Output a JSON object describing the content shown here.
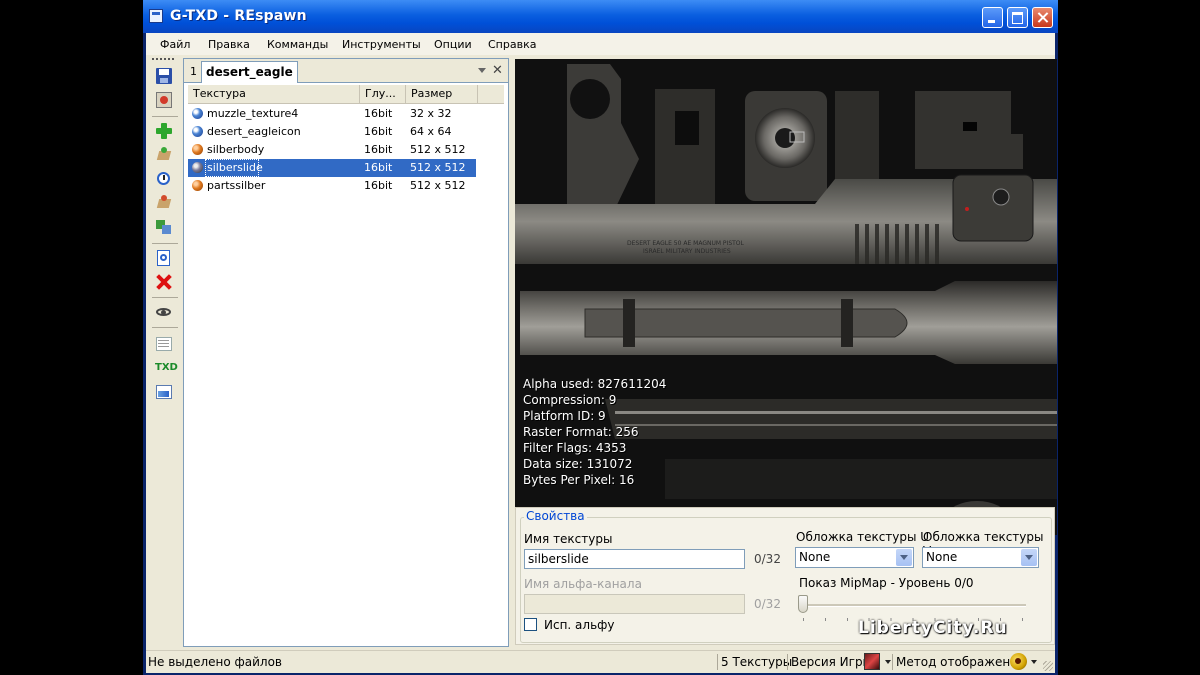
{
  "window": {
    "title": "G-TXD - REspawn"
  },
  "menu": [
    "Файл",
    "Правка",
    "Комманды",
    "Инструменты",
    "Опции",
    "Справка"
  ],
  "tab": {
    "index": "1",
    "name": "desert_eagle"
  },
  "list": {
    "headers": [
      "Текстура",
      "Глу...",
      "Размер"
    ],
    "rows": [
      {
        "name": "muzzle_texture4",
        "depth": "16bit",
        "size": "32 x 32",
        "icon": "alpha-texture-icon"
      },
      {
        "name": "desert_eagleicon",
        "depth": "16bit",
        "size": "64 x 64",
        "icon": "alpha-texture-icon"
      },
      {
        "name": "silberbody",
        "depth": "16bit",
        "size": "512 x 512",
        "icon": "opaque-texture-icon"
      },
      {
        "name": "silberslide",
        "depth": "16bit",
        "size": "512 x 512",
        "icon": "gray-texture-icon",
        "selected": true
      },
      {
        "name": "partssilber",
        "depth": "16bit",
        "size": "512 x 512",
        "icon": "opaque-texture-icon"
      }
    ]
  },
  "preview": {
    "engraving_line1": "DESERT EAGLE 50 AE MAGNUM PISTOL",
    "engraving_line2": "ISRAEL MILITARY INDUSTRIES",
    "info": [
      "Alpha used: 827611204",
      "Compression: 9",
      "Platform ID: 9",
      "Raster Format: 256",
      "Filter Flags: 4353",
      "Data size: 131072",
      "Bytes Per Pixel: 16"
    ]
  },
  "properties": {
    "title": "Свойства",
    "name_label": "Имя текстуры",
    "name_value": "silberslide",
    "name_count": "0/32",
    "alpha_label": "Имя альфа-канала",
    "alpha_value": "",
    "alpha_count": "0/32",
    "use_alpha_label": "Исп. альфу",
    "use_alpha_checked": false,
    "wrap_u_label": "Обложка текстуры U",
    "wrap_u_value": "None",
    "wrap_v_label": "Обложка текстуры V",
    "wrap_v_value": "None",
    "mipmap_label": "Показ MipMap - Уровень 0/0",
    "mipmap_level": 0
  },
  "watermark": "LibertyCity.Ru",
  "status": {
    "left": "Не выделено файлов",
    "textures": "5 Текстуры",
    "game_version": "Версия Игры",
    "render_method": "Метод отображения"
  }
}
